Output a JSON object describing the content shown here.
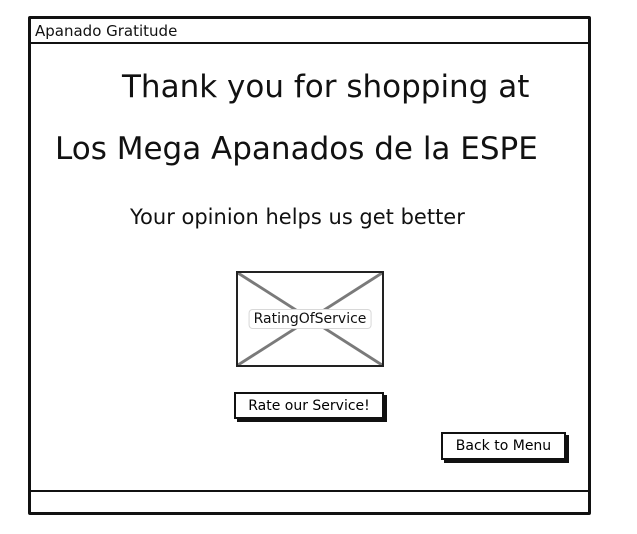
{
  "window": {
    "title": "Apanado Gratitude"
  },
  "main": {
    "heading_line1": "Thank you for shopping at",
    "heading_line2": "Los Mega Apanados de la ESPE",
    "subheading": "Your opinion helps us get better",
    "image_placeholder_label": "RatingOfService",
    "rate_button_label": "Rate our Service!",
    "back_button_label": "Back to Menu"
  },
  "colors": {
    "border": "#111111",
    "background": "#ffffff",
    "placeholder_cross": "#7a7a7a"
  }
}
